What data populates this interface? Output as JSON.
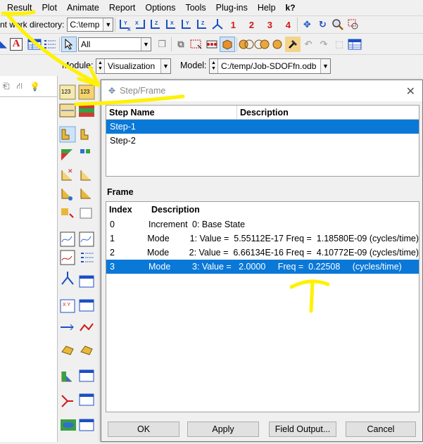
{
  "menu": {
    "items": [
      "Result",
      "Plot",
      "Animate",
      "Report",
      "Options",
      "Tools",
      "Plug-ins",
      "Help"
    ],
    "whats_this": "k?"
  },
  "toolbar": {
    "work_dir_label": "nt work directory:",
    "work_dir_value": "C:\\temp",
    "view_numbers": [
      "1",
      "2",
      "3",
      "4"
    ],
    "selection_filter": "All"
  },
  "module_bar": {
    "module_label": "Module:",
    "module_value": "Visualization",
    "model_label": "Model:",
    "model_value": "C:/temp/Job-SDOFfn.odb"
  },
  "dialog": {
    "title": "Step/Frame",
    "step_table": {
      "headers": [
        "Step Name",
        "Description"
      ],
      "rows": [
        {
          "name": "Step-1",
          "description": "",
          "selected": true
        },
        {
          "name": "Step-2",
          "description": "",
          "selected": false
        }
      ]
    },
    "frame_label": "Frame",
    "frame_table": {
      "headers": [
        "Index",
        "Description"
      ],
      "rows": [
        {
          "index": "0",
          "type": "Increment",
          "desc": "0: Base State",
          "selected": false
        },
        {
          "index": "1",
          "type": "Mode",
          "desc": "1: Value =  5.55112E-17 Freq =  1.18580E-09 (cycles/time)",
          "selected": false
        },
        {
          "index": "2",
          "type": "Mode",
          "desc": "2: Value =  6.66134E-16 Freq =  4.10772E-09 (cycles/time)",
          "selected": false
        },
        {
          "index": "3",
          "type": "Mode",
          "desc": "3: Value =   2.0000     Freq =  0.22508     (cycles/time)",
          "selected": true
        }
      ]
    },
    "buttons": {
      "ok": "OK",
      "apply": "Apply",
      "field_output": "Field Output...",
      "cancel": "Cancel"
    }
  },
  "colors": {
    "selection": "#0a78d7",
    "annotation": "#fff200",
    "accent_blue": "#1b4fc4",
    "accent_red": "#d01818"
  }
}
